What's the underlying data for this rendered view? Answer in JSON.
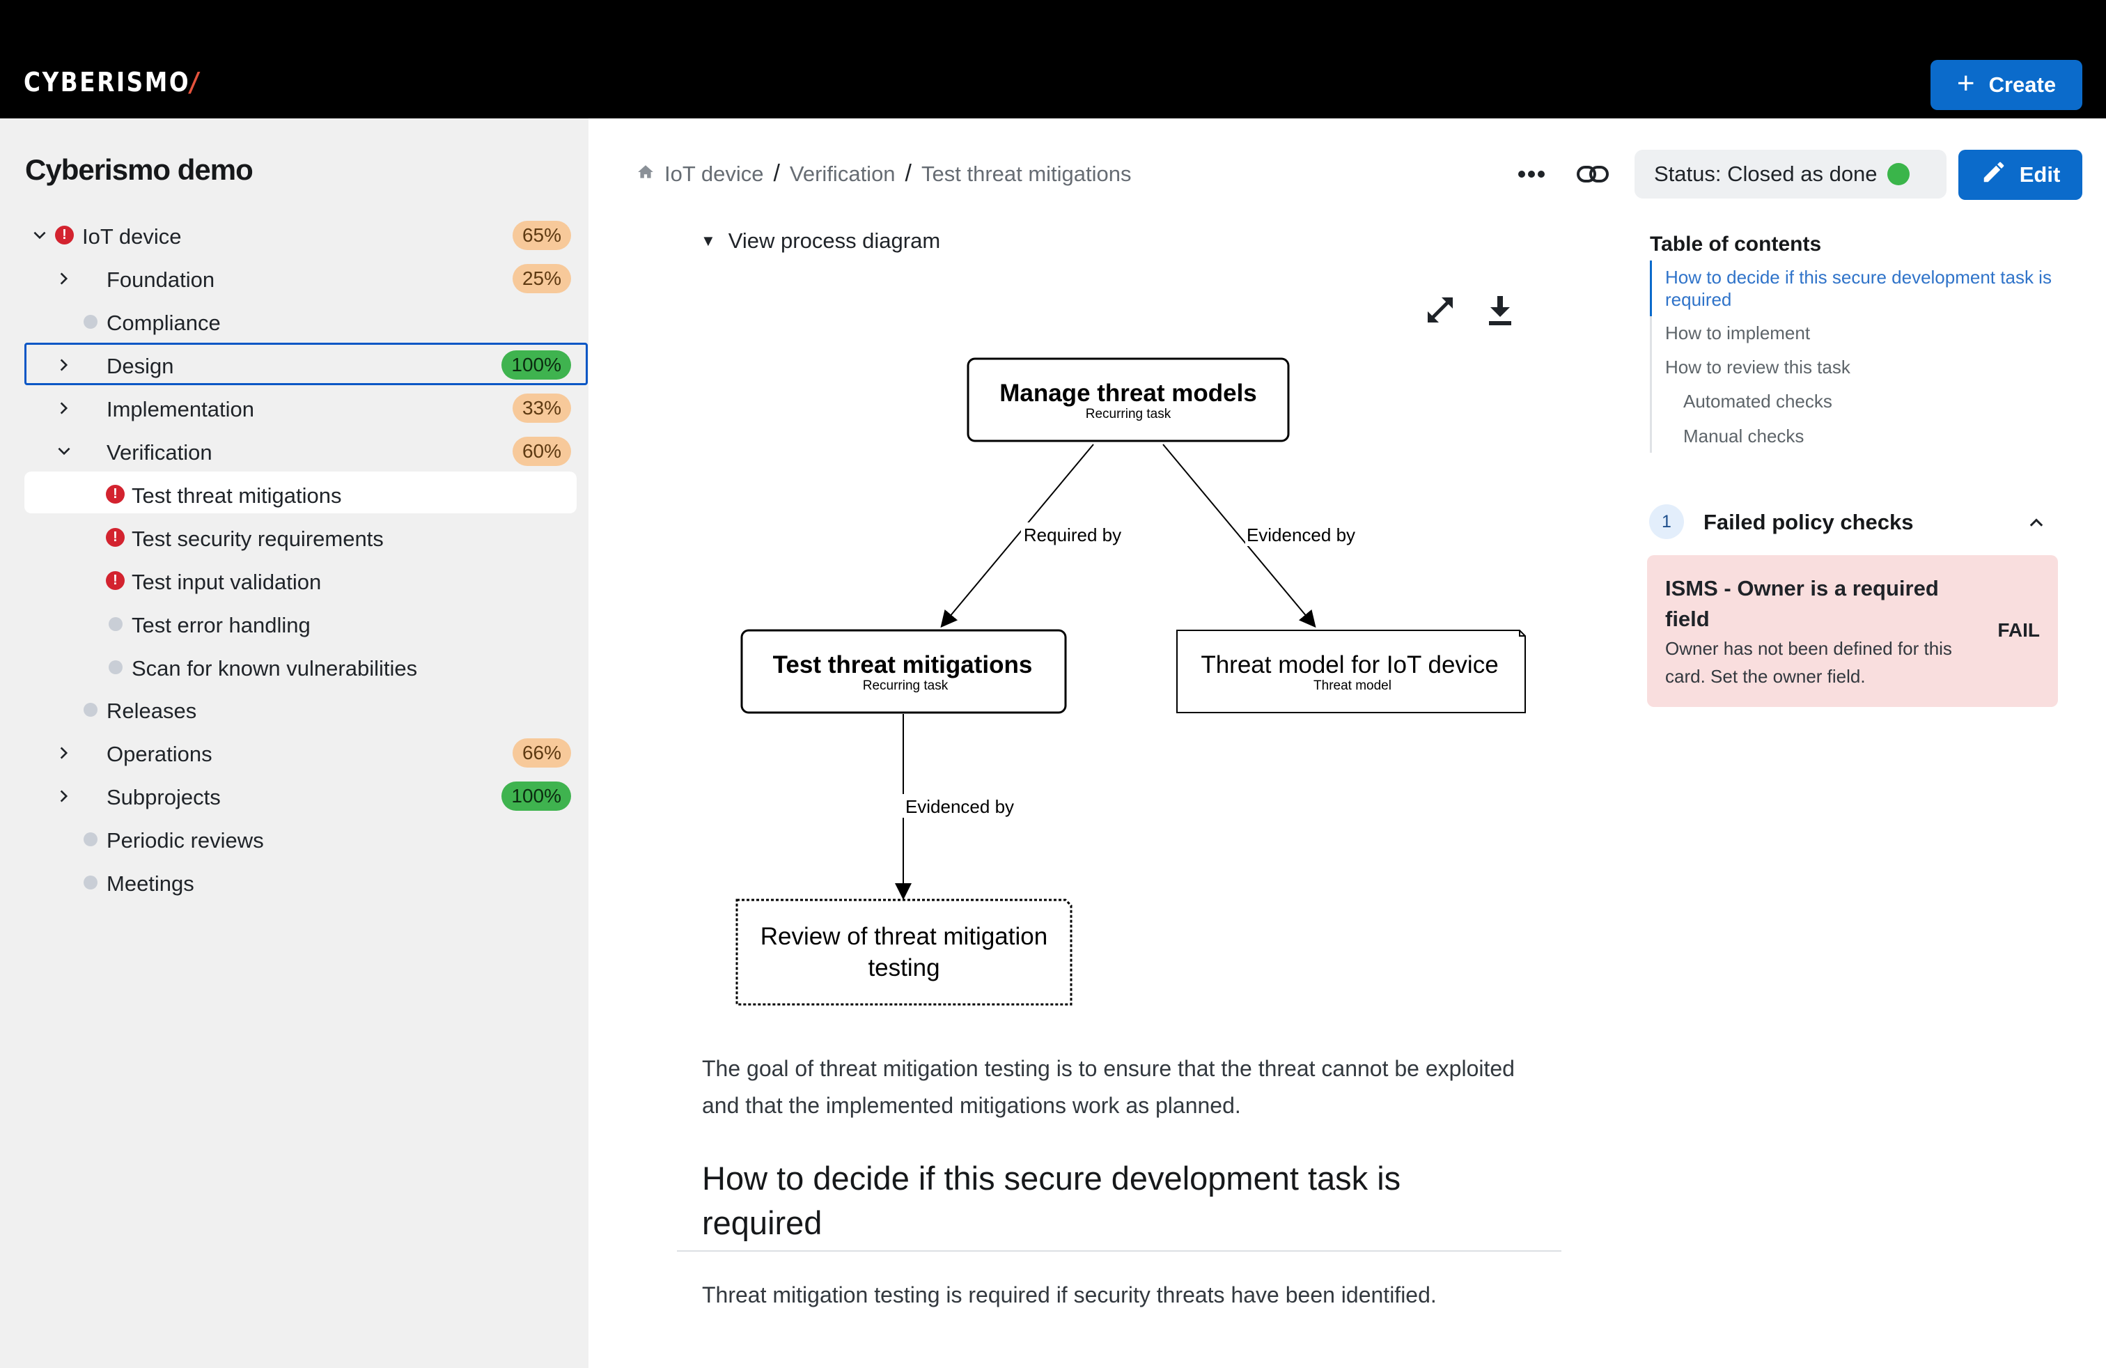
{
  "app": {
    "logo": "CYBERISMO",
    "logo_accent": "/",
    "create_label": "Create"
  },
  "sidebar": {
    "project_title": "Cyberismo demo",
    "items": [
      {
        "label": "IoT device",
        "badge": "65%",
        "status": "error",
        "expanded": true
      },
      {
        "label": "Foundation",
        "badge": "25%",
        "expanded": false
      },
      {
        "label": "Compliance"
      },
      {
        "label": "Design",
        "badge": "100%",
        "expanded": false,
        "selected": true
      },
      {
        "label": "Implementation",
        "badge": "33%",
        "expanded": false
      },
      {
        "label": "Verification",
        "badge": "60%",
        "expanded": true
      },
      {
        "label": "Test threat mitigations",
        "status": "error",
        "active": true
      },
      {
        "label": "Test security requirements",
        "status": "error"
      },
      {
        "label": "Test input validation",
        "status": "error"
      },
      {
        "label": "Test error handling"
      },
      {
        "label": "Scan for known vulnerabilities"
      },
      {
        "label": "Releases"
      },
      {
        "label": "Operations",
        "badge": "66%",
        "expanded": false
      },
      {
        "label": "Subprojects",
        "badge": "100%",
        "expanded": false
      },
      {
        "label": "Periodic reviews"
      },
      {
        "label": "Meetings"
      }
    ]
  },
  "breadcrumb": [
    "IoT device",
    "Verification",
    "Test threat mitigations"
  ],
  "status": {
    "label": "Status: Closed as done",
    "color": "#3ab54a"
  },
  "edit_label": "Edit",
  "view_diagram_label": "View process diagram",
  "diagram": {
    "nodes": {
      "manage": {
        "title": "Manage threat models",
        "subtitle": "Recurring task"
      },
      "test": {
        "title": "Test threat mitigations",
        "subtitle": "Recurring task"
      },
      "model": {
        "title": "Threat model for IoT device",
        "subtitle": "Threat model"
      },
      "review": {
        "title_line1": "Review of threat mitigation",
        "title_line2": "testing"
      }
    },
    "edges": {
      "required_by": "Required by",
      "evidenced_by_1": "Evidenced by",
      "evidenced_by_2": "Evidenced by"
    }
  },
  "content": {
    "intro": "The goal of threat mitigation testing is to ensure that the threat cannot be exploited and that the implemented mitigations work as planned.",
    "heading": "How to decide if this secure development task is required",
    "body": "Threat mitigation testing is required if security threats have been identified."
  },
  "toc": {
    "title": "Table of contents",
    "items": [
      "How to decide if this secure development task is required",
      "How to implement",
      "How to review this task",
      "Automated checks",
      "Manual checks"
    ]
  },
  "policy_checks": {
    "count": "1",
    "title": "Failed policy checks",
    "card": {
      "name": "ISMS - Owner is a required field",
      "description": "Owner has not been defined for this card. Set the owner field.",
      "result": "FAIL"
    }
  }
}
